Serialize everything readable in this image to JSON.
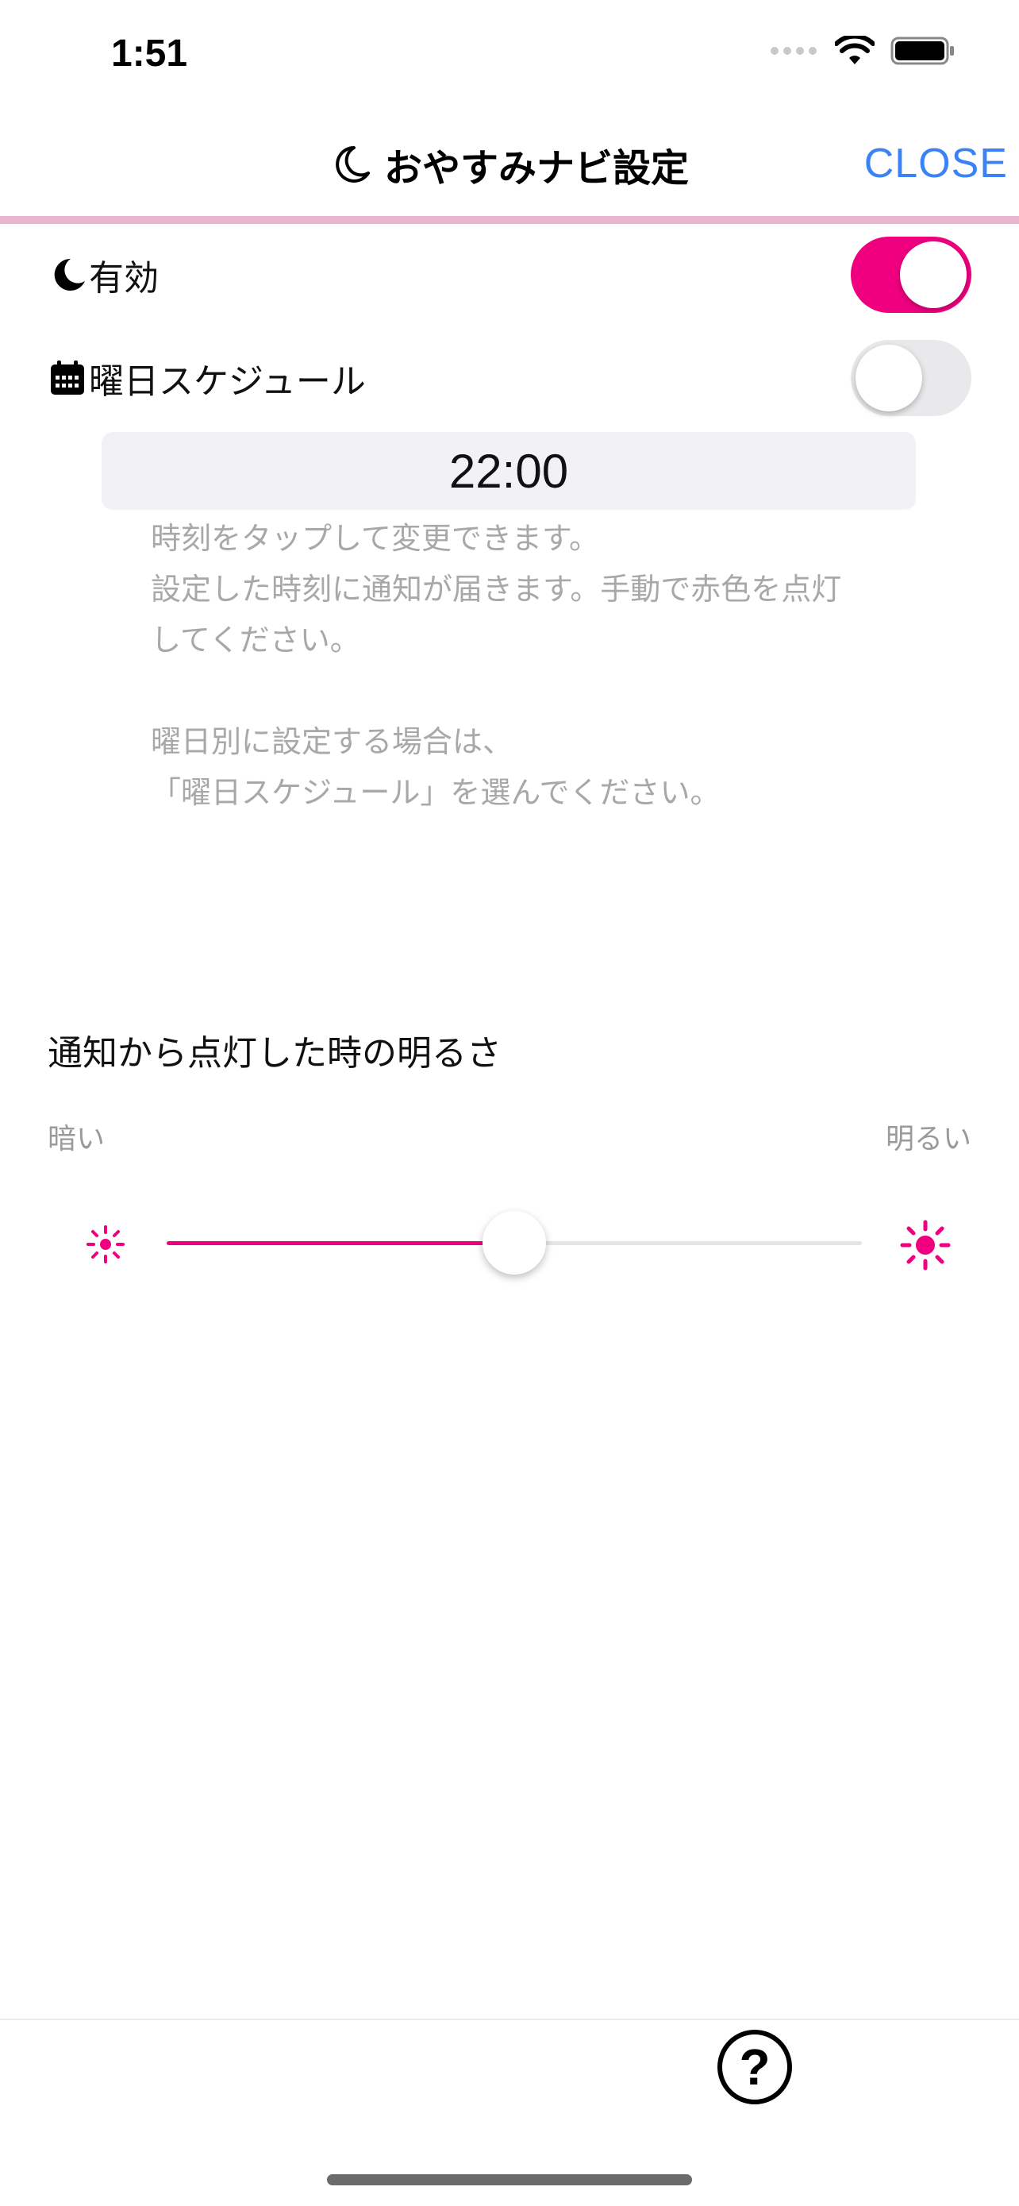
{
  "status_bar": {
    "time": "1:51",
    "icons": [
      "cellular-signal-icon",
      "wifi-icon",
      "battery-icon"
    ]
  },
  "nav": {
    "title_icon": "moon-icon",
    "title": "おやすみナビ設定",
    "close_label": "CLOSE"
  },
  "settings": {
    "enabled": {
      "icon": "moon-icon",
      "label": "有効",
      "on": true
    },
    "weekday_schedule": {
      "icon": "calendar-icon",
      "label": "曜日スケジュール",
      "on": false
    },
    "time": "22:00",
    "help_lines": {
      "line1": "時刻をタップして変更できます。",
      "line2": "設定した時刻に通知が届きます。手動で赤色を点灯",
      "line3": "してください。",
      "line4": "曜日別に設定する場合は、",
      "line5": "「曜日スケジュール」を選んでください。"
    }
  },
  "brightness": {
    "title": "通知から点灯した時の明るさ",
    "min_label": "暗い",
    "max_label": "明るい",
    "value": 0.5
  },
  "colors": {
    "accent": "#f0007f",
    "link": "#3b82f6",
    "divider": "#eab5cf"
  },
  "footer": {
    "help_icon": "question-circle-icon"
  }
}
